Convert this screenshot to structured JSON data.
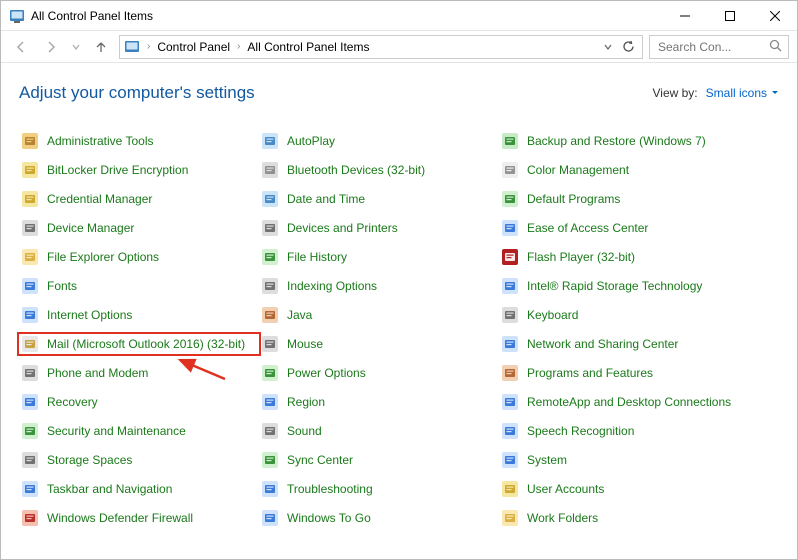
{
  "window": {
    "title": "All Control Panel Items"
  },
  "breadcrumb": {
    "items": [
      "Control Panel",
      "All Control Panel Items"
    ]
  },
  "search": {
    "placeholder": "Search Con..."
  },
  "header": {
    "heading": "Adjust your computer's settings",
    "viewby_label": "View by:",
    "viewby_value": "Small icons"
  },
  "items": [
    {
      "label": "Administrative Tools",
      "icon": "tools"
    },
    {
      "label": "AutoPlay",
      "icon": "autoplay"
    },
    {
      "label": "Backup and Restore (Windows 7)",
      "icon": "backup"
    },
    {
      "label": "BitLocker Drive Encryption",
      "icon": "bitlocker"
    },
    {
      "label": "Bluetooth Devices (32-bit)",
      "icon": "bluetooth"
    },
    {
      "label": "Color Management",
      "icon": "color"
    },
    {
      "label": "Credential Manager",
      "icon": "credentials"
    },
    {
      "label": "Date and Time",
      "icon": "clock"
    },
    {
      "label": "Default Programs",
      "icon": "defaults"
    },
    {
      "label": "Device Manager",
      "icon": "device-mgr"
    },
    {
      "label": "Devices and Printers",
      "icon": "printer"
    },
    {
      "label": "Ease of Access Center",
      "icon": "ease"
    },
    {
      "label": "File Explorer Options",
      "icon": "folder-options"
    },
    {
      "label": "File History",
      "icon": "history"
    },
    {
      "label": "Flash Player (32-bit)",
      "icon": "flash"
    },
    {
      "label": "Fonts",
      "icon": "fonts"
    },
    {
      "label": "Indexing Options",
      "icon": "indexing"
    },
    {
      "label": "Intel® Rapid Storage Technology",
      "icon": "intel"
    },
    {
      "label": "Internet Options",
      "icon": "globe"
    },
    {
      "label": "Java",
      "icon": "java"
    },
    {
      "label": "Keyboard",
      "icon": "keyboard"
    },
    {
      "label": "Mail (Microsoft Outlook 2016) (32-bit)",
      "icon": "mail",
      "highlighted": true
    },
    {
      "label": "Mouse",
      "icon": "mouse"
    },
    {
      "label": "Network and Sharing Center",
      "icon": "network"
    },
    {
      "label": "Phone and Modem",
      "icon": "phone"
    },
    {
      "label": "Power Options",
      "icon": "power"
    },
    {
      "label": "Programs and Features",
      "icon": "programs"
    },
    {
      "label": "Recovery",
      "icon": "recovery"
    },
    {
      "label": "Region",
      "icon": "region"
    },
    {
      "label": "RemoteApp and Desktop Connections",
      "icon": "remote"
    },
    {
      "label": "Security and Maintenance",
      "icon": "security"
    },
    {
      "label": "Sound",
      "icon": "sound"
    },
    {
      "label": "Speech Recognition",
      "icon": "speech"
    },
    {
      "label": "Storage Spaces",
      "icon": "storage"
    },
    {
      "label": "Sync Center",
      "icon": "sync"
    },
    {
      "label": "System",
      "icon": "system"
    },
    {
      "label": "Taskbar and Navigation",
      "icon": "taskbar"
    },
    {
      "label": "Troubleshooting",
      "icon": "troubleshoot"
    },
    {
      "label": "User Accounts",
      "icon": "users"
    },
    {
      "label": "Windows Defender Firewall",
      "icon": "firewall"
    },
    {
      "label": "Windows To Go",
      "icon": "wtg"
    },
    {
      "label": "Work Folders",
      "icon": "workfolders"
    }
  ],
  "icons": {
    "tools": {
      "fg": "#b17a2a",
      "bg": "#f0d080"
    },
    "autoplay": {
      "fg": "#3a7fbf",
      "bg": "#cce4f7"
    },
    "backup": {
      "fg": "#2a8a2a",
      "bg": "#c7eac7"
    },
    "bitlocker": {
      "fg": "#c9a227",
      "bg": "#f5e7a0"
    },
    "bluetooth": {
      "fg": "#888",
      "bg": "#ddd"
    },
    "color": {
      "fg": "#888",
      "bg": "#eee"
    },
    "credentials": {
      "fg": "#c9a227",
      "bg": "#f5e7a0"
    },
    "clock": {
      "fg": "#3a7fbf",
      "bg": "#cce4f7"
    },
    "defaults": {
      "fg": "#2a8a2a",
      "bg": "#d0f0d0"
    },
    "device-mgr": {
      "fg": "#666",
      "bg": "#ddd"
    },
    "printer": {
      "fg": "#666",
      "bg": "#ddd"
    },
    "ease": {
      "fg": "#2a6fd4",
      "bg": "#cfe2fb"
    },
    "folder-options": {
      "fg": "#d6a93a",
      "bg": "#fbe8b0"
    },
    "history": {
      "fg": "#2a8a2a",
      "bg": "#d0f0d0"
    },
    "flash": {
      "fg": "#fff",
      "bg": "#b02020"
    },
    "fonts": {
      "fg": "#2a6fd4",
      "bg": "#cfe2fb"
    },
    "indexing": {
      "fg": "#666",
      "bg": "#ddd"
    },
    "intel": {
      "fg": "#2a6fd4",
      "bg": "#cfe2fb"
    },
    "globe": {
      "fg": "#2a6fd4",
      "bg": "#cfe2fb"
    },
    "java": {
      "fg": "#b05a2a",
      "bg": "#f0d0b0"
    },
    "keyboard": {
      "fg": "#666",
      "bg": "#ddd"
    },
    "mail": {
      "fg": "#c59a2c",
      "bg": "#e8e8e8"
    },
    "mouse": {
      "fg": "#666",
      "bg": "#ddd"
    },
    "network": {
      "fg": "#2a6fd4",
      "bg": "#cfe2fb"
    },
    "phone": {
      "fg": "#666",
      "bg": "#ddd"
    },
    "power": {
      "fg": "#2a8a2a",
      "bg": "#d0f0d0"
    },
    "programs": {
      "fg": "#b05a2a",
      "bg": "#f0d0b0"
    },
    "recovery": {
      "fg": "#2a6fd4",
      "bg": "#cfe2fb"
    },
    "region": {
      "fg": "#2a6fd4",
      "bg": "#cfe2fb"
    },
    "remote": {
      "fg": "#2a6fd4",
      "bg": "#cfe2fb"
    },
    "security": {
      "fg": "#2a8a2a",
      "bg": "#d0f0d0"
    },
    "sound": {
      "fg": "#666",
      "bg": "#ddd"
    },
    "speech": {
      "fg": "#2a6fd4",
      "bg": "#cfe2fb"
    },
    "storage": {
      "fg": "#666",
      "bg": "#ddd"
    },
    "sync": {
      "fg": "#2a8a2a",
      "bg": "#d0f0d0"
    },
    "system": {
      "fg": "#2a6fd4",
      "bg": "#cfe2fb"
    },
    "taskbar": {
      "fg": "#2a6fd4",
      "bg": "#cfe2fb"
    },
    "troubleshoot": {
      "fg": "#2a6fd4",
      "bg": "#cfe2fb"
    },
    "users": {
      "fg": "#c9a227",
      "bg": "#f5e7a0"
    },
    "firewall": {
      "fg": "#b02020",
      "bg": "#f5c0b0"
    },
    "wtg": {
      "fg": "#2a6fd4",
      "bg": "#cfe2fb"
    },
    "workfolders": {
      "fg": "#d6a93a",
      "bg": "#fbe8b0"
    }
  }
}
